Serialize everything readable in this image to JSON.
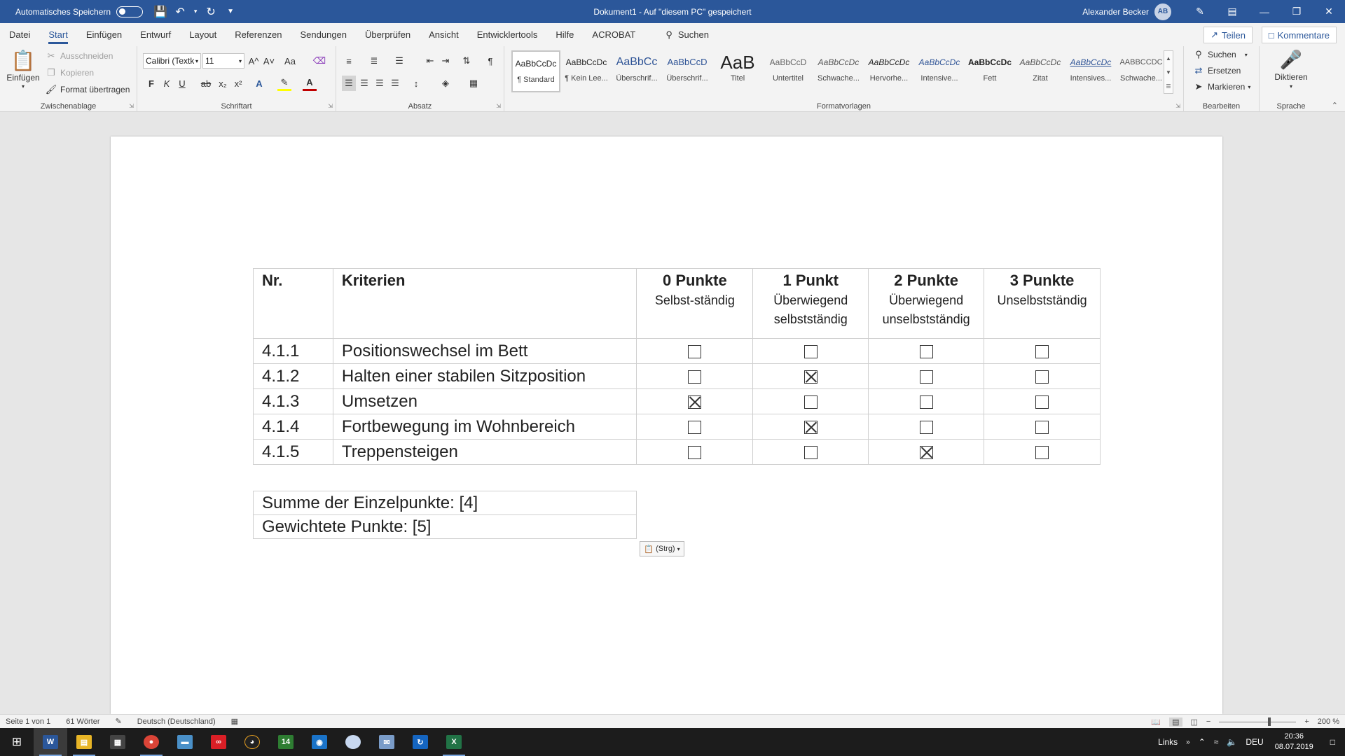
{
  "titlebar": {
    "autosave_label": "Automatisches Speichern",
    "document_title": "Dokument1  -  Auf \"diesem PC\" gespeichert",
    "user_name": "Alexander Becker",
    "user_initials": "AB"
  },
  "tabs": [
    "Datei",
    "Start",
    "Einfügen",
    "Entwurf",
    "Layout",
    "Referenzen",
    "Sendungen",
    "Überprüfen",
    "Ansicht",
    "Entwicklertools",
    "Hilfe",
    "ACROBAT"
  ],
  "active_tab": "Start",
  "search_label": "Suchen",
  "share_label": "Teilen",
  "comments_label": "Kommentare",
  "ribbon": {
    "clipboard": {
      "label": "Zwischenablage",
      "paste": "Einfügen",
      "cut": "Ausschneiden",
      "copy": "Kopieren",
      "format_painter": "Format übertragen"
    },
    "font": {
      "label": "Schriftart",
      "font_name": "Calibri (Textk",
      "font_size": "11",
      "bold": "F",
      "italic": "K",
      "underline": "U",
      "strike": "ab",
      "sub": "x₂",
      "sup": "x²",
      "grow": "A^",
      "shrink": "A˅",
      "case": "Aa",
      "effects": "A",
      "highlight": "✎",
      "color": "A"
    },
    "paragraph": {
      "label": "Absatz"
    },
    "styles": {
      "label": "Formatvorlagen",
      "items": [
        {
          "preview": "AaBbCcDc",
          "name": "¶ Standard"
        },
        {
          "preview": "AaBbCcDc",
          "name": "¶ Kein Lee..."
        },
        {
          "preview": "AaBbCc",
          "name": "Überschrif..."
        },
        {
          "preview": "AaBbCcD",
          "name": "Überschrif..."
        },
        {
          "preview": "AaB",
          "name": "Titel"
        },
        {
          "preview": "AaBbCcD",
          "name": "Untertitel"
        },
        {
          "preview": "AaBbCcDc",
          "name": "Schwache..."
        },
        {
          "preview": "AaBbCcDc",
          "name": "Hervorhe..."
        },
        {
          "preview": "AaBbCcDc",
          "name": "Intensive..."
        },
        {
          "preview": "AaBbCcDc",
          "name": "Fett"
        },
        {
          "preview": "AaBbCcDc",
          "name": "Zitat"
        },
        {
          "preview": "AaBbCcDc",
          "name": "Intensives..."
        },
        {
          "preview": "AABBCCDC",
          "name": "Schwache..."
        }
      ]
    },
    "editing": {
      "label": "Bearbeiten",
      "find": "Suchen",
      "replace": "Ersetzen",
      "select": "Markieren"
    },
    "voice": {
      "label": "Sprache",
      "dictate": "Diktieren"
    }
  },
  "table": {
    "headers": [
      {
        "title": "Nr.",
        "sub": ""
      },
      {
        "title": "Kriterien",
        "sub": ""
      },
      {
        "title": "0 Punkte",
        "sub": "Selbst-ständig"
      },
      {
        "title": "1 Punkt",
        "sub": "Überwiegend selbstständig"
      },
      {
        "title": "2 Punkte",
        "sub": "Überwiegend unselbstständig"
      },
      {
        "title": "3 Punkte",
        "sub": "Unselbstständig"
      }
    ],
    "rows": [
      {
        "nr": "4.1.1",
        "criterion": "Positionswechsel im Bett",
        "checks": [
          false,
          false,
          false,
          false
        ]
      },
      {
        "nr": "4.1.2",
        "criterion": "Halten einer stabilen Sitzposition",
        "checks": [
          false,
          true,
          false,
          false
        ]
      },
      {
        "nr": "4.1.3",
        "criterion": "Umsetzen",
        "checks": [
          true,
          false,
          false,
          false
        ]
      },
      {
        "nr": "4.1.4",
        "criterion": "Fortbewegung im Wohnbereich",
        "checks": [
          false,
          true,
          false,
          false
        ]
      },
      {
        "nr": "4.1.5",
        "criterion": "Treppensteigen",
        "checks": [
          false,
          false,
          true,
          false
        ]
      }
    ]
  },
  "summary": {
    "sum": "Summe der Einzelpunkte: [4]",
    "weighted": "Gewichtete Punkte: [5]"
  },
  "paste_options": "(Strg)",
  "statusbar": {
    "page": "Seite 1 von 1",
    "words": "61 Wörter",
    "language": "Deutsch (Deutschland)",
    "zoom": "200 %"
  },
  "taskbar": {
    "links_label": "Links",
    "lang": "DEU",
    "time": "20:36",
    "date": "08.07.2019",
    "badge_14": "14"
  }
}
